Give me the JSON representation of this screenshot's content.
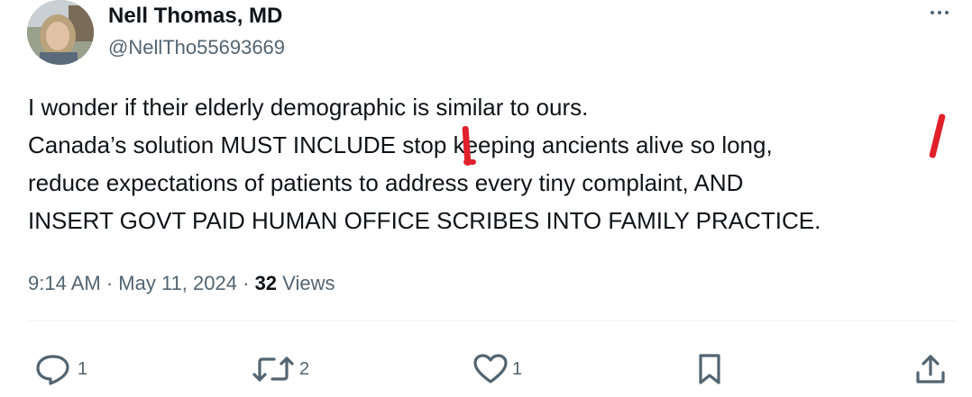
{
  "author": {
    "name": "Nell Thomas, MD",
    "handle": "@NellTho55693669"
  },
  "tweet": {
    "lines": [
      "I wonder if their elderly demographic is similar to ours.",
      "Canada’s solution MUST INCLUDE stop keeping ancients alive so long,",
      "reduce expectations of patients to address every tiny complaint, AND",
      "INSERT GOVT PAID HUMAN OFFICE SCRIBES INTO FAMILY PRACTICE."
    ]
  },
  "meta": {
    "time": "9:14 AM",
    "separator": "·",
    "date": "May 11, 2024",
    "views_count": "32",
    "views_label": "Views"
  },
  "actions": {
    "reply_count": "1",
    "retweet_count": "2",
    "like_count": "1"
  },
  "colors": {
    "text": "#0f1419",
    "secondary": "#536471",
    "annotation": "#e0202a"
  },
  "icons": [
    "more-icon",
    "reply-icon",
    "retweet-icon",
    "like-icon",
    "bookmark-icon",
    "share-icon"
  ]
}
